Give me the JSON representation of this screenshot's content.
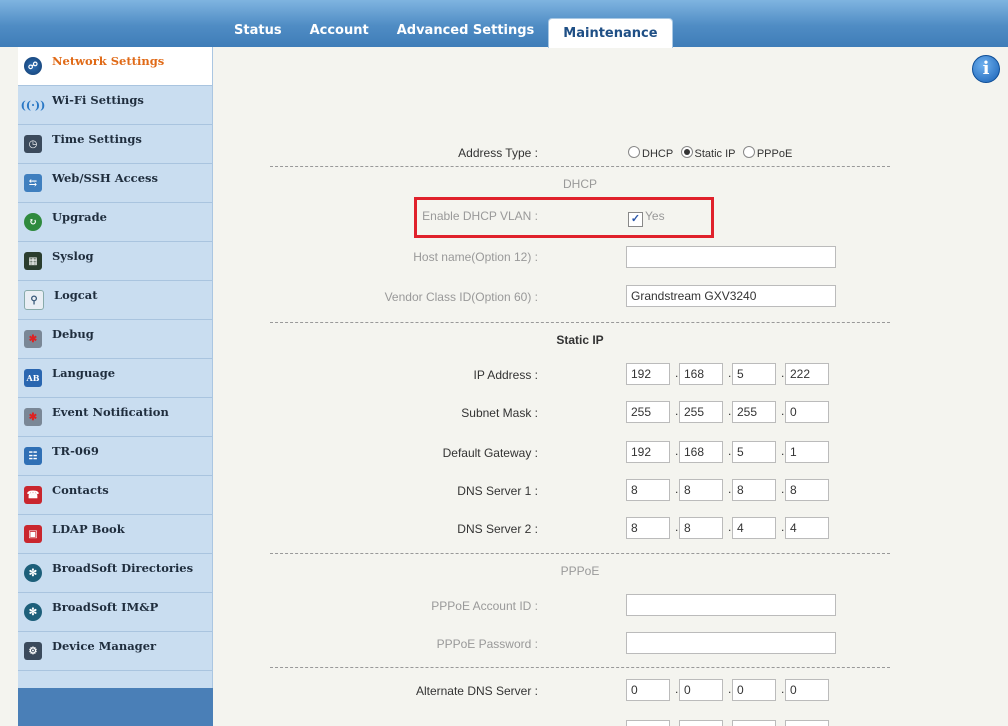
{
  "tabs": [
    {
      "label": "Status"
    },
    {
      "label": "Account"
    },
    {
      "label": "Advanced Settings"
    },
    {
      "label": "Maintenance"
    }
  ],
  "sidebar": {
    "items": [
      {
        "label": "Network Settings",
        "icon": "network-icon",
        "active": true
      },
      {
        "label": "Wi-Fi Settings",
        "icon": "wifi-icon"
      },
      {
        "label": "Time Settings",
        "icon": "clock-icon"
      },
      {
        "label": "Web/SSH Access",
        "icon": "web-access-icon"
      },
      {
        "label": "Upgrade",
        "icon": "upgrade-icon"
      },
      {
        "label": "Syslog",
        "icon": "syslog-icon"
      },
      {
        "label": "Logcat",
        "icon": "logcat-icon"
      },
      {
        "label": "Debug",
        "icon": "debug-icon"
      },
      {
        "label": "Language",
        "icon": "language-icon"
      },
      {
        "label": "Event Notification",
        "icon": "event-notification-icon"
      },
      {
        "label": "TR-069",
        "icon": "tr069-icon"
      },
      {
        "label": "Contacts",
        "icon": "contacts-icon"
      },
      {
        "label": "LDAP Book",
        "icon": "ldap-book-icon"
      },
      {
        "label": "BroadSoft Directories",
        "icon": "broadsoft-icon"
      },
      {
        "label": "BroadSoft IM&P",
        "icon": "broadsoft-icon"
      },
      {
        "label": "Device Manager",
        "icon": "device-manager-icon"
      }
    ]
  },
  "form": {
    "address_type": {
      "label": "Address Type :",
      "options": [
        "DHCP",
        "Static IP",
        "PPPoE"
      ],
      "selected": "Static IP"
    },
    "dhcp": {
      "section": "DHCP",
      "enable_vlan_label": "Enable DHCP VLAN :",
      "enable_vlan_value": "Yes",
      "hostname_label": "Host name(Option 12) :",
      "hostname_value": "",
      "vendor_label": "Vendor Class ID(Option 60) :",
      "vendor_value": "Grandstream GXV3240"
    },
    "static_ip": {
      "section": "Static IP",
      "rows": [
        {
          "label": "IP Address :",
          "octets": [
            "192",
            "168",
            "5",
            "222"
          ]
        },
        {
          "label": "Subnet Mask :",
          "octets": [
            "255",
            "255",
            "255",
            "0"
          ]
        },
        {
          "label": "Default Gateway :",
          "octets": [
            "192",
            "168",
            "5",
            "1"
          ]
        },
        {
          "label": "DNS Server 1 :",
          "octets": [
            "8",
            "8",
            "8",
            "8"
          ]
        },
        {
          "label": "DNS Server 2 :",
          "octets": [
            "8",
            "8",
            "4",
            "4"
          ]
        }
      ]
    },
    "pppoe": {
      "section": "PPPoE",
      "account_label": "PPPoE Account ID :",
      "account_value": "",
      "password_label": "PPPoE Password :",
      "password_value": ""
    },
    "alternate_dns": {
      "label": "Alternate DNS Server :",
      "octets": [
        "0",
        "0",
        "0",
        "0"
      ]
    },
    "dot": "."
  },
  "colors": {
    "header": "#4f8cc4",
    "sidebar": "#c9ddf0",
    "active_item": "#e06a17",
    "highlight": "#e0212b"
  }
}
